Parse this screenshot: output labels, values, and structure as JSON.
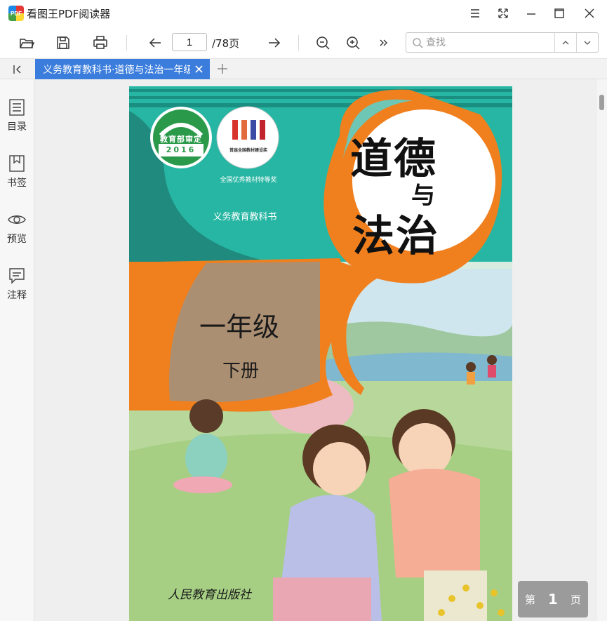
{
  "app": {
    "logo_text": "PDF",
    "title": "看图王PDF阅读器"
  },
  "toolbar": {
    "current_page": "1",
    "total_pages": "/78页",
    "search_placeholder": "查找"
  },
  "tab": {
    "label": "义务教育教科书·道德与法治一年级下册"
  },
  "sidebar": {
    "items": [
      {
        "label": "目录",
        "icon": "toc-icon"
      },
      {
        "label": "书签",
        "icon": "bookmark-icon"
      },
      {
        "label": "预览",
        "icon": "eye-icon"
      },
      {
        "label": "注释",
        "icon": "comment-icon"
      }
    ]
  },
  "cover": {
    "badge1_top": "教育部审定",
    "badge1_year": "2016",
    "badge2_text": "首届全国教材建设奖",
    "award": "全国优秀教材特等奖",
    "series": "义务教育教科书",
    "title_1": "道德",
    "title_2": "与",
    "title_3": "法治",
    "grade": "一年级",
    "volume": "下册",
    "publisher": "人民教育出版社"
  },
  "page_indicator": {
    "prefix": "第",
    "number": "1",
    "suffix": "页"
  },
  "colors": {
    "tab_active": "#3b7ddd",
    "cover_teal": "#27b6a3",
    "cover_orange": "#f07f1e",
    "cover_tan": "#ab8f73"
  }
}
